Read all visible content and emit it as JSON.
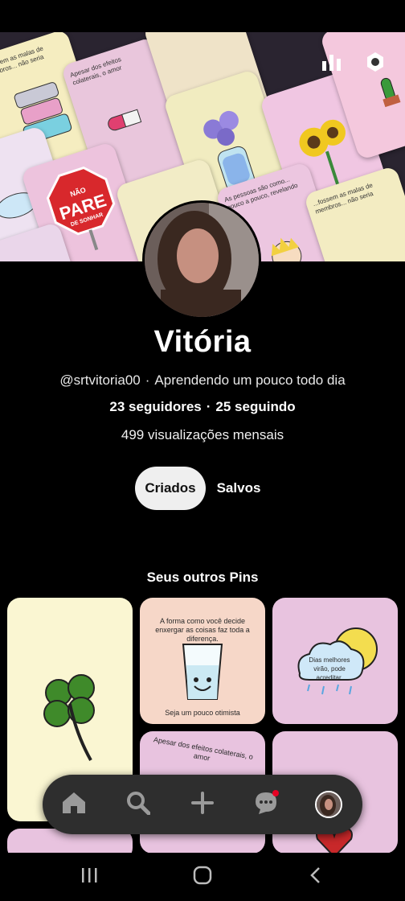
{
  "profile": {
    "name": "Vitória",
    "handle": "@srtvitoria00",
    "bio": "Aprendendo um pouco todo dia",
    "followers": "23 seguidores",
    "following": "25 seguindo",
    "monthly_views": "499 visualizações mensais"
  },
  "cover": {
    "icons": [
      "stats-icon",
      "settings-icon"
    ],
    "tile_texts": {
      "suitcases": "...fossem as malas de membros... não seria",
      "pills": "Apesar dos efeitos colaterais, o amor",
      "top": "Seja um pouco otimista",
      "stop_sign_top": "NÃO",
      "stop_sign_main": "PARE",
      "stop_sign_bottom": "DE SONHAR",
      "prince": "As pessoas são como... pouco a pouco, revelando",
      "suitcases2": "...fossem as malas de membros... não seria"
    }
  },
  "tabs": [
    {
      "label": "Criados",
      "active": true
    },
    {
      "label": "Salvos",
      "active": false
    }
  ],
  "section": {
    "title": "Seus outros Pins"
  },
  "pins": {
    "glass_top": "A forma como você decide enxergar as coisas faz toda a diferença.",
    "glass_bottom": "Seja um pouco otimista",
    "cloud": "Dias melhores virão, pode acreditar.",
    "pills": "Apesar dos efeitos colaterais, o amor"
  },
  "bottom_nav": {
    "items": [
      "home-icon",
      "search-icon",
      "create-icon",
      "messages-icon",
      "profile-avatar"
    ]
  },
  "system_nav": [
    "recents-icon",
    "home-circle-icon",
    "back-icon"
  ],
  "colors": {
    "accent": "#e60023",
    "tab_active_bg": "#efefef",
    "nav_bg": "#2e2e2e",
    "pin_yellow": "#faf6d2",
    "pin_peach": "#f6d7c8",
    "pin_pink": "#e8c3df"
  }
}
